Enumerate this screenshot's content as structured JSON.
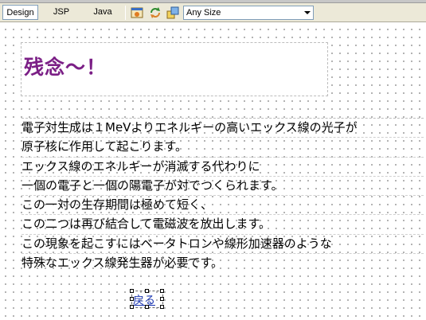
{
  "toolbar": {
    "tabs": [
      {
        "label": "Design"
      },
      {
        "label": "JSP"
      },
      {
        "label": "Java"
      }
    ],
    "icons": [
      "preview-page-icon",
      "refresh-icon",
      "layout-icon"
    ],
    "size_select": {
      "value": "Any Size"
    }
  },
  "page": {
    "title": "残念～！",
    "lines": [
      "電子対生成は１MeVよりエネルギーの高いエックス線の光子が",
      "原子核に作用して起こります。",
      "エックス線のエネルギーが消滅する代わりに",
      "一個の電子と一個の陽電子が対でつくられます。",
      "この一対の生存期間は極めて短く、",
      "この二つは再び結合して電磁波を放出します。",
      "この現象を起こすにはベータトロンや線形加速器のような",
      "特殊なエックス線発生器が必要です。"
    ],
    "back_link": "戻る"
  },
  "colors": {
    "title": "#7b1f86",
    "link": "#1a35b0",
    "toolbar_bg": "#ece9d8"
  }
}
